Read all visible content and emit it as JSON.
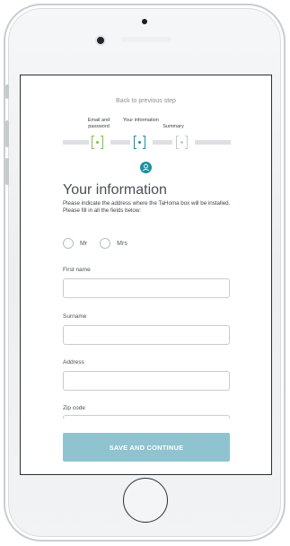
{
  "header": {
    "back_link": "Back to previous step"
  },
  "steps": [
    {
      "label": "Email and password",
      "state": "completed",
      "color": "#7cc242"
    },
    {
      "label": "Your information",
      "state": "active",
      "color": "#1e8fa0"
    },
    {
      "label": "Summary",
      "state": "pending",
      "color": "#c5c9cd"
    }
  ],
  "step_icon": "user-icon",
  "page": {
    "title": "Your information",
    "intro": "Please indicate the address where the TaHoma box will be installed. Please fill in all the fields below:"
  },
  "title_radio": {
    "options": [
      "Mr",
      "Mrs"
    ],
    "selected": null
  },
  "fields": {
    "first_name": {
      "label": "First name",
      "value": ""
    },
    "surname": {
      "label": "Surname",
      "value": ""
    },
    "address": {
      "label": "Address",
      "value": ""
    },
    "zip_code": {
      "label": "Zip code",
      "value": ""
    }
  },
  "actions": {
    "save_label": "SAVE AND CONTINUE"
  },
  "colors": {
    "accent": "#1e8fa0",
    "button": "#8fc3cf",
    "done": "#7cc242"
  }
}
